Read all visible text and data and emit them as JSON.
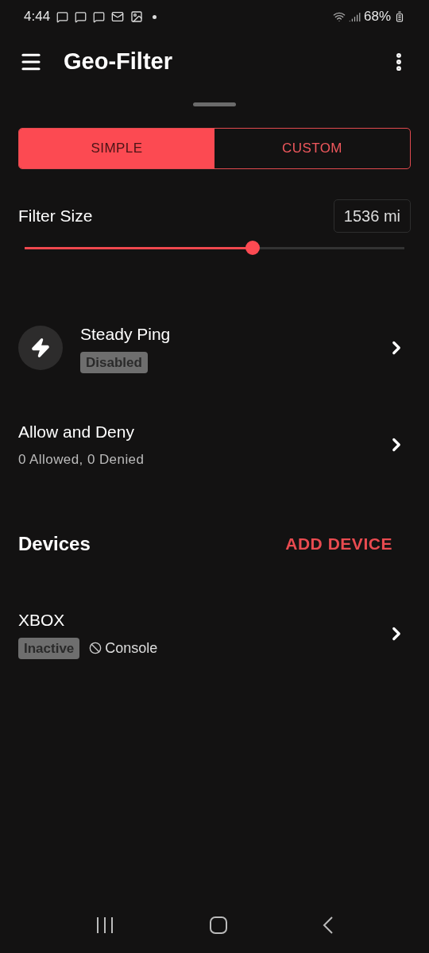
{
  "status_bar": {
    "time": "4:44",
    "battery": "68%"
  },
  "app_bar": {
    "title": "Geo-Filter"
  },
  "mode_tabs": [
    {
      "label": "SIMPLE",
      "selected": true
    },
    {
      "label": "CUSTOM",
      "selected": false
    }
  ],
  "filter_size": {
    "label": "Filter Size",
    "reading": "1536 mi",
    "level": 0.6
  },
  "settings": [
    {
      "kind": "icon",
      "title": "Steady Ping",
      "badge": "Disabled"
    },
    {
      "kind": "plain",
      "title": "Allow and Deny",
      "subtitle": "0 Allowed, 0 Denied"
    }
  ],
  "devices": {
    "title": "Devices",
    "action": "ADD DEVICE",
    "items": [
      {
        "name": "XBOX",
        "status": "Inactive",
        "type": "Console"
      }
    ]
  }
}
